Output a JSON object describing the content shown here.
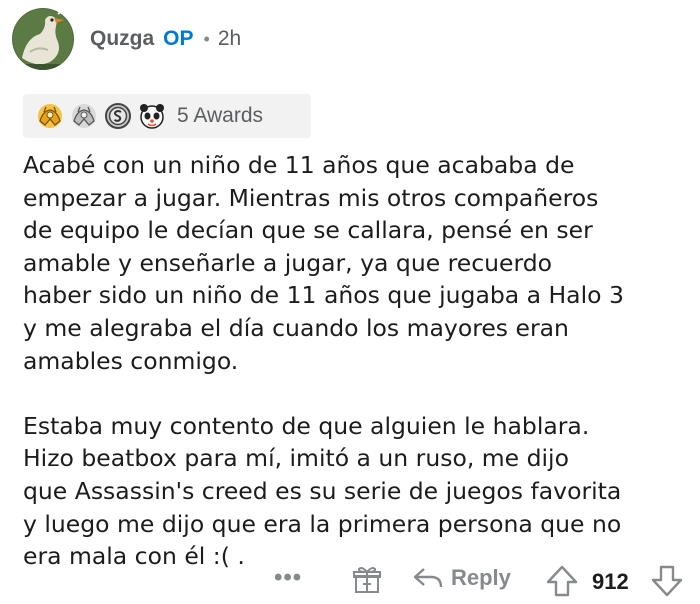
{
  "author": {
    "username": "Quzga",
    "op_label": "OP",
    "separator": "•",
    "time_ago": "2h",
    "avatar_icon": "goose-avatar-icon"
  },
  "awards": {
    "label": "5 Awards",
    "icons": [
      "gold-hands-award-icon",
      "silver-hands-award-icon",
      "silver-coin-award-icon",
      "panda-face-award-icon"
    ]
  },
  "comment": {
    "paragraph1_lines": [
      "Acabé con un niño de 11 años que acababa de",
      "empezar a jugar. Mientras mis otros compañeros",
      "de equipo le decían que se callara, pensé en ser",
      "amable y enseñarle a jugar, ya que recuerdo",
      "haber sido un niño de 11 años que jugaba a Halo 3",
      "y me alegraba el día cuando los mayores eran",
      "amables conmigo."
    ],
    "paragraph2_lines": [
      "Estaba muy contento de que alguien le hablara.",
      "Hizo beatbox para mí, imitó a un ruso, me dijo",
      "que Assassin's creed es su serie de juegos favorita",
      "y luego me dijo que era la primera persona que no",
      "era mala con él :( ."
    ]
  },
  "actions": {
    "more_label": "•••",
    "reply_label": "Reply",
    "score": "912",
    "icons": [
      "gift-icon",
      "reply-arrow-icon",
      "upvote-icon",
      "downvote-icon"
    ]
  },
  "colors": {
    "op_blue": "#0079d3",
    "meta_gray": "#878a8c",
    "awards_bg": "#f2f2f2",
    "text": "#1c1c1c"
  }
}
